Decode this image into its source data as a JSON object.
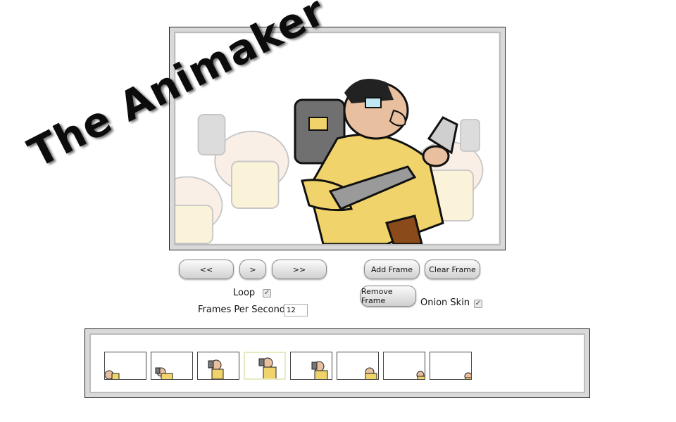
{
  "app": {
    "title": "The Animaker"
  },
  "controls": {
    "prev_label": "<<",
    "play_label": ">",
    "next_label": ">>",
    "add_frame_label": "Add Frame",
    "clear_frame_label": "Clear Frame",
    "remove_frame_label": "Remove Frame",
    "loop_label": "Loop",
    "loop_checked": true,
    "fps_label": "Frames Per Second",
    "fps_value": "12",
    "onion_label": "Onion Skin",
    "onion_checked": true
  },
  "filmstrip": {
    "frame_count": 8,
    "current_index": 3
  },
  "colors": {
    "accent_current_frame": "#e5ebc0",
    "jacket": "#f0d36a",
    "skin": "#e8c0a0",
    "backpack": "#6f6f6f"
  }
}
